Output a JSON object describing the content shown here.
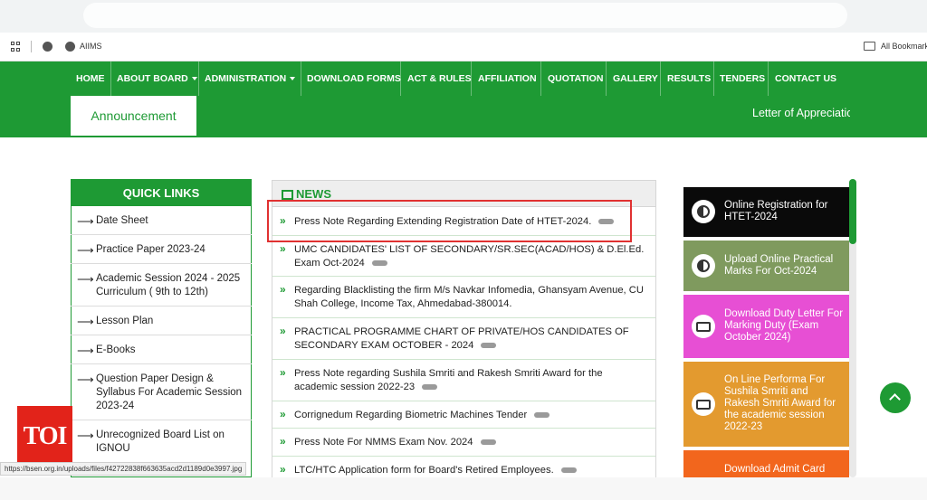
{
  "browser": {
    "bookmark_label": "AIIMS",
    "all_bookmarks": "All Bookmarks",
    "status_url": "https://bsen.org.in/uploads/files/f42722838f663635acd2d1189d0e3997.jpg"
  },
  "nav": {
    "items": [
      {
        "label": "HOME"
      },
      {
        "label": "ABOUT BOARD"
      },
      {
        "label": "ADMINISTRATION"
      },
      {
        "label": "DOWNLOAD FORMS"
      },
      {
        "label": "ACT & RULES"
      },
      {
        "label": "AFFILIATION"
      },
      {
        "label": "QUOTATION"
      },
      {
        "label": "GALLERY"
      },
      {
        "label": "RESULTS"
      },
      {
        "label": "TENDERS"
      },
      {
        "label": "CONTACT US"
      }
    ]
  },
  "announcement": {
    "tab": "Announcement",
    "ticker": "Letter of Appreciatio"
  },
  "quick_links": {
    "title": "QUICK LINKS",
    "items": [
      {
        "label": "Date Sheet"
      },
      {
        "label": "Practice Paper 2023-24"
      },
      {
        "label": "Academic Session 2024 - 2025 Curriculum ( 9th to 12th)"
      },
      {
        "label": "Lesson Plan"
      },
      {
        "label": "E-Books"
      },
      {
        "label": "Question Paper Design & Syllabus For Academic Session 2023-24"
      },
      {
        "label": "Unrecognized Board List on IGNOU"
      }
    ]
  },
  "news": {
    "title": "NEWS",
    "items": [
      {
        "text": "Press Note Regarding Extending Registration Date of HTET-2024."
      },
      {
        "text": "UMC CANDIDATES' LIST OF SECONDARY/SR.SEC(ACAD/HOS) & D.El.Ed. Exam Oct-2024"
      },
      {
        "text": "Regarding Blacklisting the firm M/s Navkar Infomedia, Ghansyam Avenue, CU Shah College, Income Tax, Ahmedabad-380014."
      },
      {
        "text": "PRACTICAL PROGRAMME CHART OF PRIVATE/HOS CANDIDATES OF SECONDARY EXAM OCTOBER - 2024"
      },
      {
        "text": "Press Note regarding Sushila Smriti and Rakesh Smriti Award for the academic session 2022-23"
      },
      {
        "text": "Corrignedum Regarding Biometric Machines Tender"
      },
      {
        "text": "Press Note For NMMS Exam Nov. 2024"
      },
      {
        "text": "LTC/HTC Application form for Board's Retired Employees."
      }
    ]
  },
  "tiles": [
    {
      "label": "Online Registration for HTET-2024",
      "color": "#0a0a0a",
      "icon": "half-circle-icon"
    },
    {
      "label": "Upload Online Practical Marks For Oct-2024",
      "color": "#7f9a5e",
      "icon": "half-circle-icon"
    },
    {
      "label": "Download Duty Letter For Marking Duty (Exam October 2024)",
      "color": "#e74fd4",
      "icon": "id-card-icon"
    },
    {
      "label": "On Line Performa For Sushila Smriti and Rakesh Smriti Award for the academic session 2022-23",
      "color": "#e39a2f",
      "icon": "id-card-icon"
    },
    {
      "label": "Download Admit Card",
      "color": "#f2661d",
      "icon": "id-card-icon"
    }
  ],
  "watermark": {
    "text": "TOI"
  },
  "colors": {
    "brand_green": "#1e9a34",
    "highlight_red": "#e03131"
  }
}
